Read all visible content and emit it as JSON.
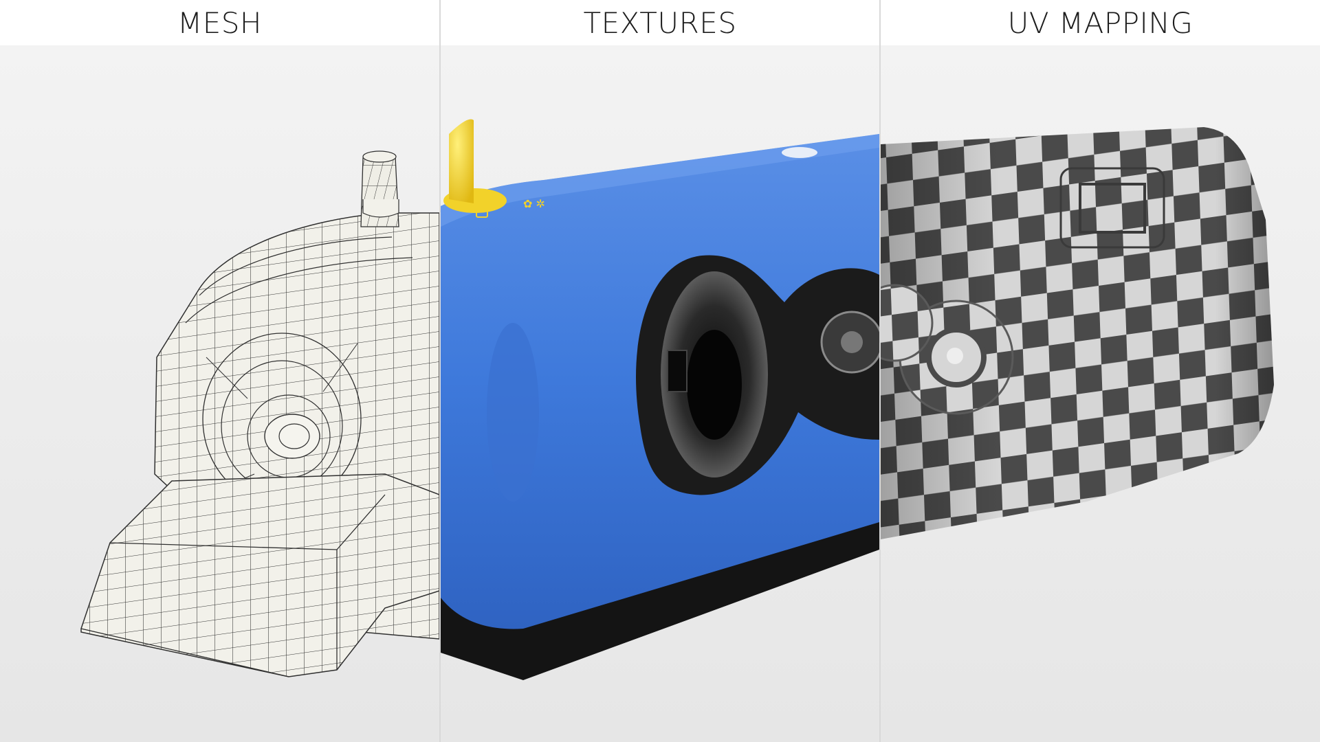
{
  "panels": [
    {
      "title": "MESH",
      "render": "wireframe-mesh"
    },
    {
      "title": "TEXTURES",
      "render": "textured-model"
    },
    {
      "title": "UV MAPPING",
      "render": "checker-uv"
    }
  ],
  "colors": {
    "header_bg": "#ffffff",
    "background": "#ececec",
    "body_blue": "#3e79db",
    "accent_yellow": "#f2d22a",
    "rubber_black": "#141414",
    "checker_dark": "#4a4a4a",
    "checker_light": "#d6d6d6",
    "wire_fill": "#f2f1ea",
    "wire_line": "#2f2f2f"
  }
}
